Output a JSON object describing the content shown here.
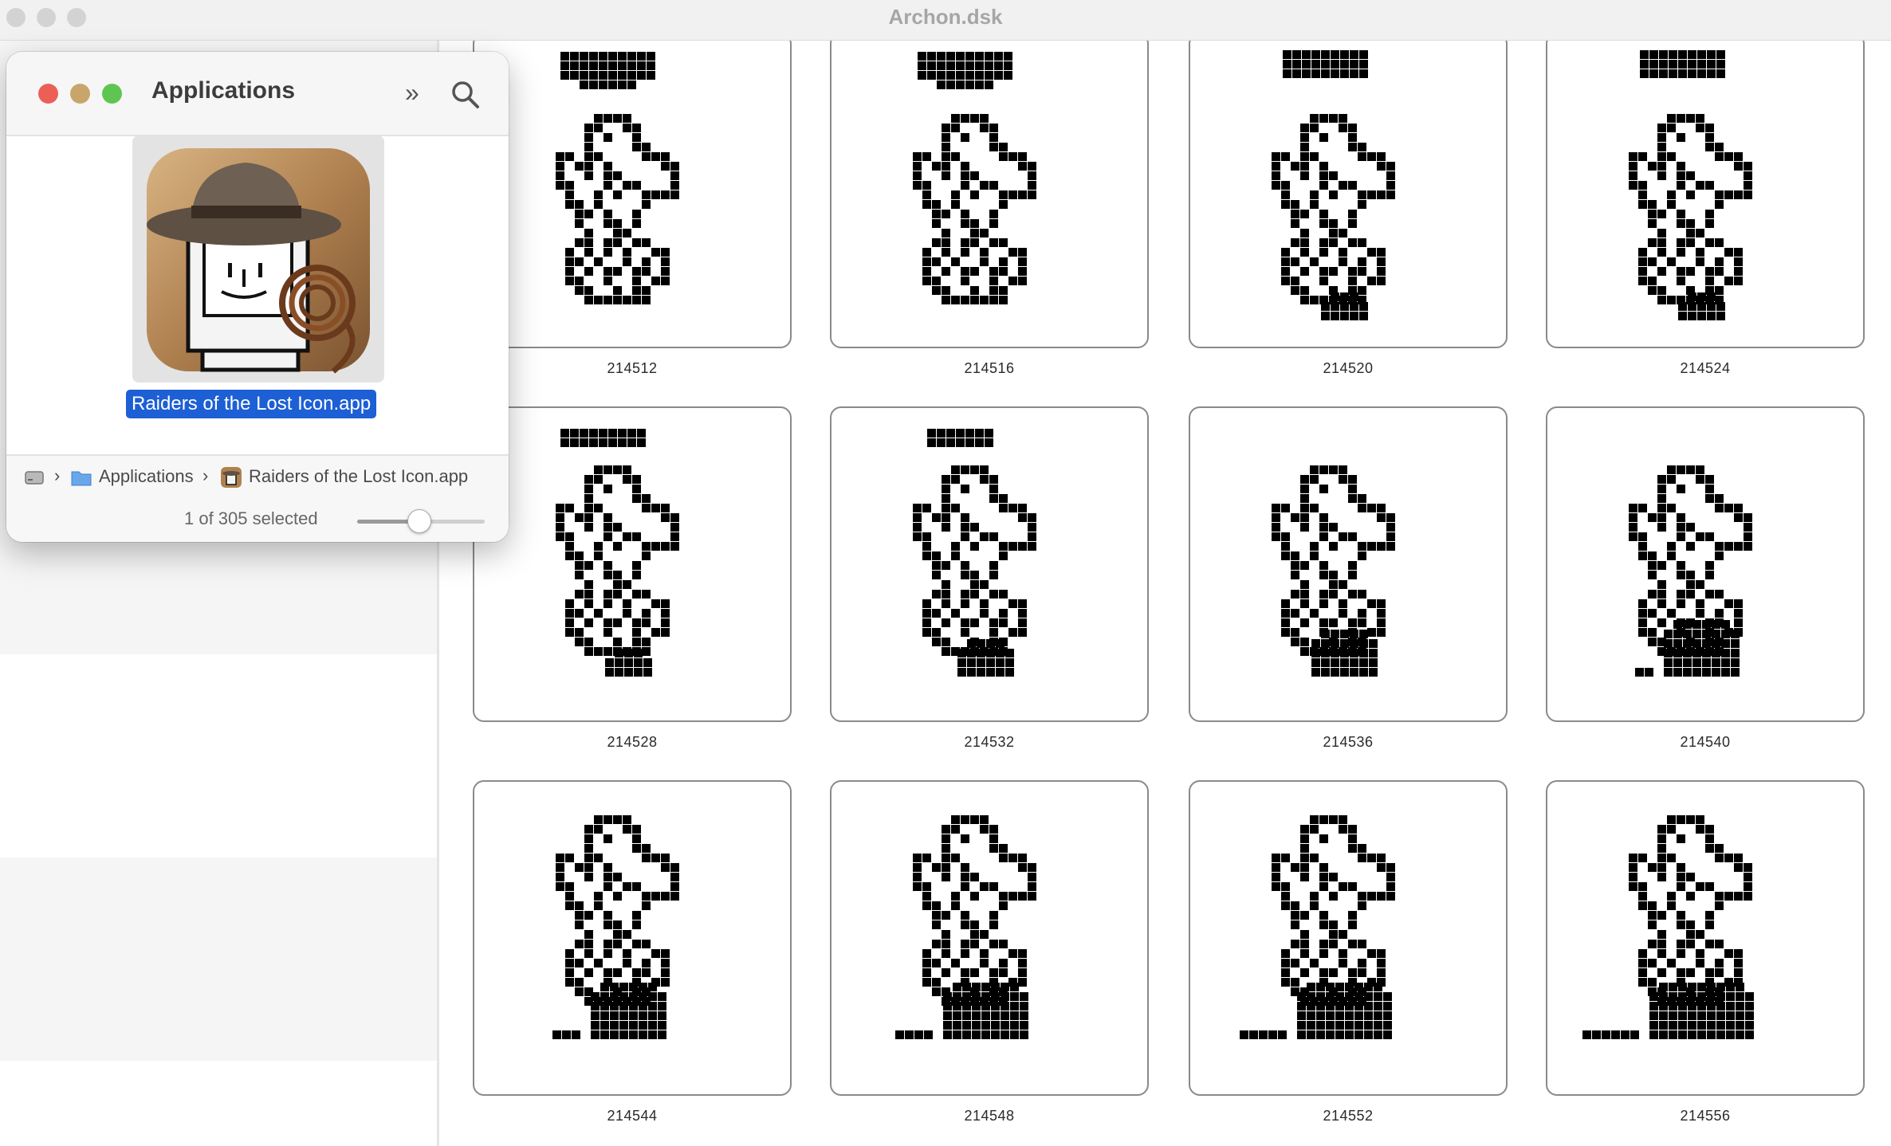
{
  "window": {
    "title": "Archon.dsk"
  },
  "popup": {
    "title": "Applications",
    "selected_item": "Raiders of the Lost Icon.app",
    "path": [
      "Applications",
      "Raiders of the Lost Icon.app"
    ],
    "status": "1 of 305 selected",
    "icon_size_level": 0.48,
    "traffic_lights": {
      "close": "#ec5f57",
      "minimize": "#c9a56b",
      "zoom": "#5fc552"
    }
  },
  "grid": {
    "items": [
      {
        "label": "214512"
      },
      {
        "label": "214516"
      },
      {
        "label": "214520"
      },
      {
        "label": "214524"
      },
      {
        "label": "214528"
      },
      {
        "label": "214532"
      },
      {
        "label": "214536"
      },
      {
        "label": "214540"
      },
      {
        "label": "214544"
      },
      {
        "label": "214548"
      },
      {
        "label": "214552"
      },
      {
        "label": "214556"
      }
    ]
  }
}
